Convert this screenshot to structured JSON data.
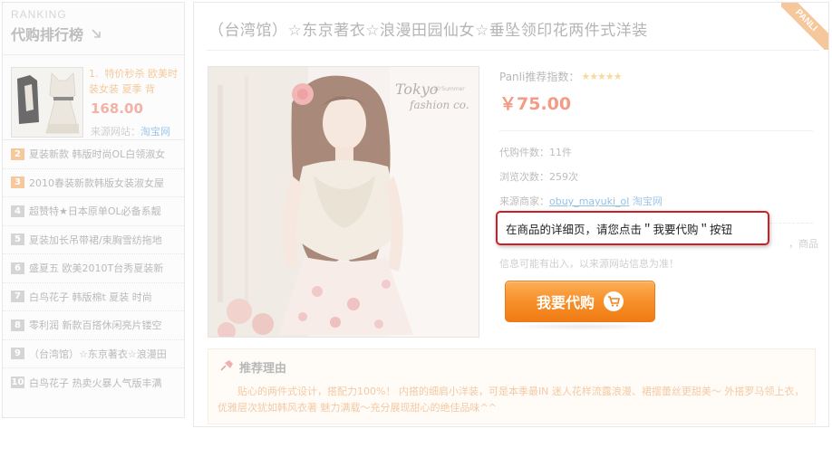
{
  "sidebar": {
    "eng_title": "RANKING",
    "title": "代购排行榜",
    "top_item": {
      "rank": "1.",
      "title": "特价秒杀 欧美时装女装 夏季 背",
      "price": "168.00",
      "source_label": "来源网站：",
      "source_value": "淘宝网"
    },
    "items": [
      {
        "num": "2",
        "text": "夏装新款 韩版时尚OL白领淑女"
      },
      {
        "num": "3",
        "text": "2010春装新款韩版女装淑女屋"
      },
      {
        "num": "4",
        "text": "超赞特★日本原单OL必备系靓"
      },
      {
        "num": "5",
        "text": "夏装加长吊带裙/束胸雪纺拖地"
      },
      {
        "num": "6",
        "text": "盛夏五 欧美2010T台秀夏装新"
      },
      {
        "num": "7",
        "text": "白鸟花子 韩版棉t 夏装 时尚"
      },
      {
        "num": "8",
        "text": "零利润 新款百搭休闲亮片镂空"
      },
      {
        "num": "9",
        "text": "（台湾馆）☆东京著衣☆浪漫田"
      },
      {
        "num": "10",
        "text": "白鸟花子 热卖火暴人气版丰满"
      }
    ]
  },
  "ribbon": "PANLI",
  "product": {
    "title": "（台湾馆）☆东京著衣☆浪漫田园仙女☆垂坠领印花两件式洋装",
    "rating_label": "Panli推荐指数：",
    "stars": "★★★★★",
    "price": "￥75.00",
    "count_label": "代购件数：",
    "count_value": "11件",
    "views_label": "浏览次数：",
    "views_value": "259次",
    "seller_label": "来源商家：",
    "seller_name": "obuy_mayuki_ol",
    "seller_site": "淘宝网",
    "notice_left": "信息可能有出入，以来源网站信息为准！",
    "notice_right": "，商品",
    "image_text_1": "Tokyo",
    "image_text_2": "fashion co.",
    "image_text_3": "10'Summer"
  },
  "buy_button": {
    "label": "我要代购"
  },
  "callout": {
    "text": "在商品的详细页，请您点击＂我要代购＂按钮"
  },
  "reason": {
    "title": "推荐理由",
    "text": "贴心的两件式设计，搭配力100%！ 内搭的细肩小洋装，可是本季最IN 迷人花样流露浪漫、裙摆蕾丝更甜美～ 外搭罗马领上衣，优雅层次犹如韩风衣著 魅力满载～充分展现甜心的绝佳品味^^"
  },
  "colors": {
    "accent_orange": "#f7922c",
    "callout_border": "#cf1f24",
    "price_color": "#f39b86",
    "link_blue": "#94c1e6"
  }
}
